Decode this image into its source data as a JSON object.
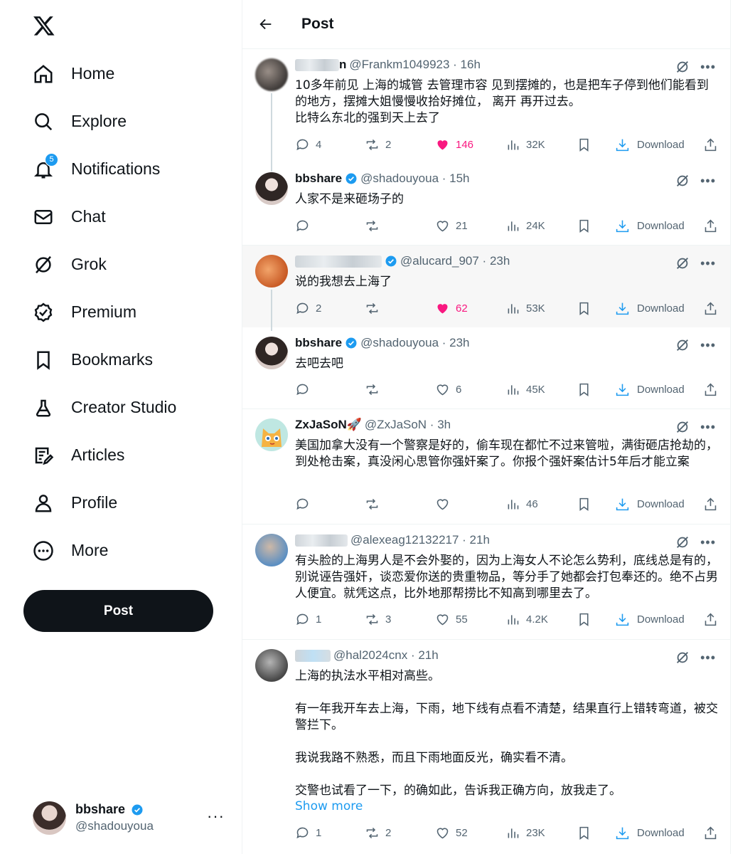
{
  "sidebar": {
    "logo": "x-logo-icon",
    "nav": [
      {
        "icon": "home-icon",
        "label": "Home"
      },
      {
        "icon": "search-icon",
        "label": "Explore"
      },
      {
        "icon": "bell-icon",
        "label": "Notifications",
        "badge": "5"
      },
      {
        "icon": "mail-icon",
        "label": "Chat"
      },
      {
        "icon": "grok-icon",
        "label": "Grok"
      },
      {
        "icon": "premium-icon",
        "label": "Premium"
      },
      {
        "icon": "bookmark-icon",
        "label": "Bookmarks"
      },
      {
        "icon": "flask-icon",
        "label": "Creator Studio"
      },
      {
        "icon": "articles-icon",
        "label": "Articles"
      },
      {
        "icon": "person-icon",
        "label": "Profile"
      },
      {
        "icon": "more-circle-icon",
        "label": "More"
      }
    ],
    "post_button": "Post",
    "account": {
      "name": "bbshare",
      "handle": "@shadouyoua",
      "more": "···"
    }
  },
  "header": {
    "title": "Post"
  },
  "tweets": [
    {
      "name_visible": "n",
      "handle_time": "@Frankm1049923 · 16h",
      "body": "10多年前见 上海的城管 去管理市容 见到摆摊的，也是把车子停到他们能看到的地方，摆摊大姐慢慢收拾好摊位， 离开 再开过去。\n比特么东北的强到天上去了",
      "replies": "4",
      "reposts": "2",
      "likes": "146",
      "views": "32K",
      "liked": true
    },
    {
      "name_visible": "bbshare",
      "handle_time": "@shadouyoua · 15h",
      "body": "人家不是来砸场子的",
      "replies": "",
      "reposts": "",
      "likes": "21",
      "views": "24K",
      "liked": false
    },
    {
      "name_visible": "",
      "handle_time": "@alucard_907 · 23h",
      "body": "说的我想去上海了",
      "replies": "2",
      "reposts": "",
      "likes": "62",
      "views": "53K",
      "liked": true
    },
    {
      "name_visible": "bbshare",
      "handle_time": "@shadouyoua · 23h",
      "body": "去吧去吧",
      "replies": "",
      "reposts": "",
      "likes": "6",
      "views": "45K",
      "liked": false
    },
    {
      "name_visible": "ZxJaSoN🚀",
      "handle_time": "@ZxJaSoN · 3h",
      "body": "美国加拿大没有一个警察是好的，偷车现在都忙不过来管啦，满街砸店抢劫的，到处枪击案，真没闲心思管你强奸案了。你报个强奸案估计5年后才能立案",
      "replies": "",
      "reposts": "",
      "likes": "",
      "views": "46",
      "liked": false
    },
    {
      "name_visible": "",
      "handle_time": "@alexeag12132217 · 21h",
      "body": "有头脸的上海男人是不会外娶的，因为上海女人不论怎么势利，底线总是有的，别说诬告强奸，谈恋爱你送的贵重物品，等分手了她都会打包奉还的。绝不占男人便宜。就凭这点，比外地那帮捞比不知高到哪里去了。",
      "replies": "1",
      "reposts": "3",
      "likes": "55",
      "views": "4.2K",
      "liked": false
    },
    {
      "name_visible": "",
      "handle_time": "@hal2024cnx · 21h",
      "body": "上海的执法水平相对高些。\n\n有一年我开车去上海，下雨，地下线有点看不清楚，结果直行上错转弯道，被交警拦下。\n\n我说我路不熟悉，而且下雨地面反光，确实看不清。\n\n交警也试看了一下，的确如此，告诉我正确方向，放我走了。",
      "show_more": "Show more",
      "replies": "1",
      "reposts": "2",
      "likes": "52",
      "views": "23K",
      "liked": false
    }
  ],
  "download_label": "Download",
  "colors": {
    "accent": "#1d9bf0",
    "like": "#f91880",
    "muted": "#536471",
    "dark": "#0f1419"
  }
}
